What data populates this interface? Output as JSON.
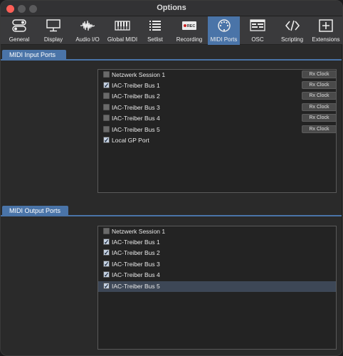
{
  "window": {
    "title": "Options"
  },
  "toolbar": {
    "items": [
      {
        "label": "General",
        "icon": "general-toggle-icon",
        "active": false
      },
      {
        "label": "Display",
        "icon": "display-monitor-icon",
        "active": false
      },
      {
        "label": "Audio I/O",
        "icon": "audio-waveform-icon",
        "active": false
      },
      {
        "label": "Global MIDI",
        "icon": "piano-keyboard-icon",
        "active": false
      },
      {
        "label": "Setlist",
        "icon": "setlist-icon",
        "active": false
      },
      {
        "label": "Recording",
        "icon": "rec-icon",
        "active": false
      },
      {
        "label": "MIDI Ports",
        "icon": "midi-din-icon",
        "active": true
      },
      {
        "label": "OSC",
        "icon": "osc-icon",
        "active": false
      },
      {
        "label": "Scripting",
        "icon": "code-brackets-icon",
        "active": false
      },
      {
        "label": "Extensions",
        "icon": "plus-box-icon",
        "active": false
      }
    ],
    "rec_badge": "REC"
  },
  "input_section": {
    "label": "MIDI Input Ports",
    "rx_label": "Rx Clock",
    "ports": [
      {
        "name": "Netzwerk Session 1",
        "checked": false,
        "rx": true
      },
      {
        "name": "IAC-Treiber Bus 1",
        "checked": true,
        "rx": true
      },
      {
        "name": "IAC-Treiber Bus 2",
        "checked": false,
        "rx": true
      },
      {
        "name": "IAC-Treiber Bus 3",
        "checked": false,
        "rx": true
      },
      {
        "name": "IAC-Treiber Bus 4",
        "checked": false,
        "rx": true
      },
      {
        "name": "IAC-Treiber Bus 5",
        "checked": false,
        "rx": true
      },
      {
        "name": "Local GP Port",
        "checked": true,
        "rx": false
      }
    ]
  },
  "output_section": {
    "label": "MIDI Output Ports",
    "ports": [
      {
        "name": "Netzwerk Session 1",
        "checked": false,
        "selected": false
      },
      {
        "name": "IAC-Treiber Bus 1",
        "checked": true,
        "selected": false
      },
      {
        "name": "IAC-Treiber Bus 2",
        "checked": true,
        "selected": false
      },
      {
        "name": "IAC-Treiber Bus 3",
        "checked": true,
        "selected": false
      },
      {
        "name": "IAC-Treiber Bus 4",
        "checked": true,
        "selected": false
      },
      {
        "name": "IAC-Treiber Bus 5",
        "checked": true,
        "selected": true
      }
    ]
  },
  "colors": {
    "accent": "#4a74a8",
    "background": "#2a2a2a",
    "close_button": "#ff5f57"
  }
}
